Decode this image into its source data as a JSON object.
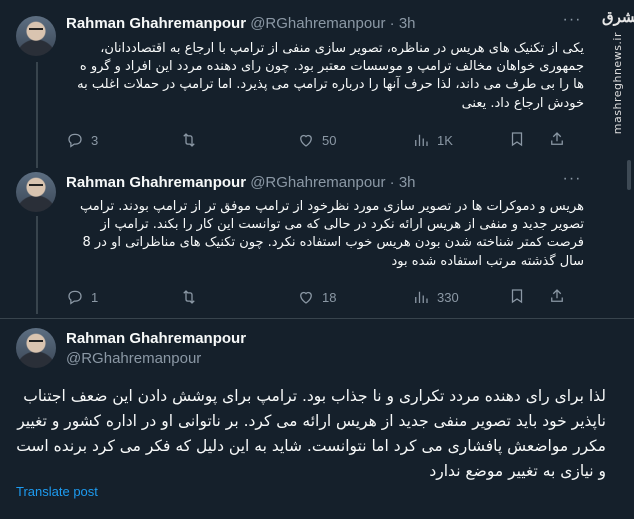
{
  "tweets": [
    {
      "author": "Rahman Ghahremanpour",
      "handle": "@RGhahremanpour",
      "separator": "·",
      "time": "3h",
      "text": "یکی از تکنیک های هریس در مناظره، تصویر سازی منفی از ترامپ با ارجاع به اقتصاددانان، جمهوری خواهان مخالف ترامپ و موسسات معتبر بود. چون  رای دهنده مردد این افراد و گرو ه ها را بی طرف می داند، لذا حرف آنها را درباره ترامپ می پذیرد. اما ترامپ  در حملات اغلب به خودش ارجاع داد. یعنی",
      "replies": "3",
      "reposts": "",
      "likes": "50",
      "views": "1K"
    },
    {
      "author": "Rahman Ghahremanpour",
      "handle": "@RGhahremanpour",
      "separator": "·",
      "time": "3h",
      "text": "هریس و دموکرات ها در تصویر سازی مورد نظرخود از ترامپ موفق تر از ترامپ بودند. ترامپ تصویر جدید و منفی از هریس ارائه نکرد در حالی که می توانست این کار را بکند. ترامپ از فرصت کمتر شناخته شدن بودن هریس خوب استفاده نکرد. چون تکنیک های مناظراتی او در 8 سال گذشته مرتب استفاده شده بود",
      "replies": "1",
      "reposts": "",
      "likes": "18",
      "views": "330"
    }
  ],
  "main_tweet": {
    "author": "Rahman Ghahremanpour",
    "handle": "@RGhahremanpour",
    "text": "لذا برای رای دهنده مردد تکراری و نا جذاب بود. ترامپ برای پوشش دادن این ضعف اجتناب ناپذیر خود باید تصویر منفی جدید از هریس ارائه می کرد. بر ناتوانی او در اداره کشور و تغییر مکرر مواضعش پافشاری می کرد اما نتوانست. شاید به این دلیل که فکر می کرد برنده است و نیازی به تغییر موضع ندارد",
    "translate_label": "Translate post"
  },
  "watermark": {
    "logo_text": "مشرق",
    "url": "mashreghnews.ir"
  },
  "colors": {
    "background": "#15202b",
    "text": "#f7f9f9",
    "muted": "#8b98a5",
    "link": "#1d9bf0",
    "border": "#38444d"
  },
  "icons": [
    "reply-icon",
    "repost-icon",
    "like-icon",
    "views-icon",
    "bookmark-icon",
    "share-icon",
    "more-icon"
  ]
}
